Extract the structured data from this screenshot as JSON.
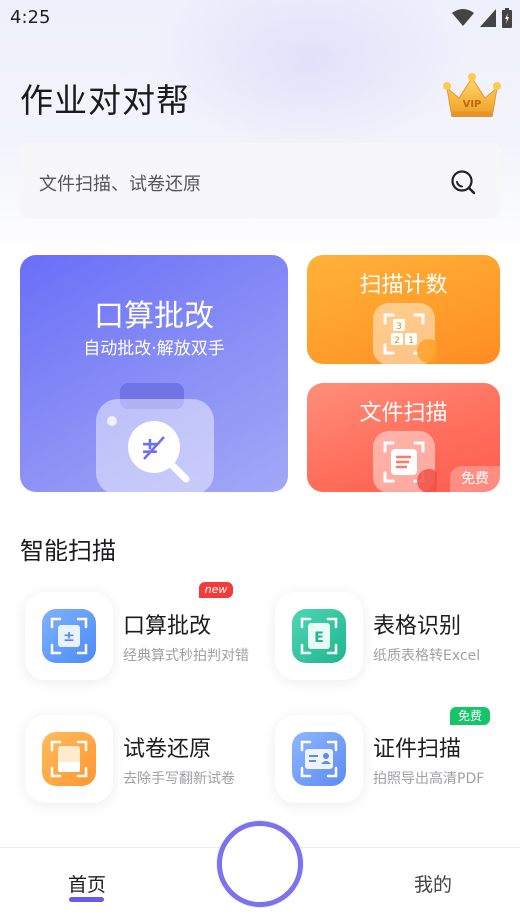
{
  "status_bar": {
    "time": "4:25"
  },
  "header": {
    "title": "作业对对帮",
    "vip_label": "VIP"
  },
  "search": {
    "placeholder": "文件扫描、试卷还原"
  },
  "cards": {
    "main": {
      "title": "口算批改",
      "subtitle": "自动批改·解放双手"
    },
    "count": {
      "title": "扫描计数"
    },
    "doc": {
      "title": "文件扫描",
      "badge": "免费"
    }
  },
  "section": {
    "title": "智能扫描"
  },
  "features": [
    {
      "title": "口算批改",
      "desc": "经典算式秒拍判对错",
      "badge": "new"
    },
    {
      "title": "表格识别",
      "desc": "纸质表格转Excel"
    },
    {
      "title": "试卷还原",
      "desc": "去除手写翻新试卷"
    },
    {
      "title": "证件扫描",
      "desc": "拍照导出高清PDF",
      "badge": "免费"
    }
  ],
  "nav": {
    "home": "首页",
    "mine": "我的"
  },
  "colors": {
    "accent": "#6b5ce7",
    "card_main": "#7a7ff6",
    "card_count": "#ff9f2b",
    "card_doc": "#ff6f5c",
    "badge_new": "#f23b3b",
    "badge_free": "#17c46a"
  },
  "icons": {
    "vip": "crown-icon",
    "search": "search-icon",
    "signal": "signal-icon",
    "wifi": "wifi-icon",
    "battery": "battery-icon"
  }
}
